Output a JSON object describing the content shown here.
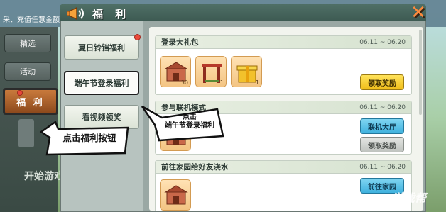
{
  "background": {
    "top_text_prefix": "采、充值任意金额",
    "rail_tabs": [
      "精选",
      "活动"
    ],
    "selected_tab_label": "福 利",
    "start_text": "开始游戏",
    "watermark": "游戏帮"
  },
  "dialog": {
    "title": "福 利",
    "close_label": "✕",
    "menu": [
      {
        "label": "夏日铃铛福利",
        "has_badge": true
      },
      {
        "label": "端午节登录福利",
        "has_badge": false,
        "active": true
      },
      {
        "label": "看视频领奖",
        "has_badge": false
      }
    ],
    "cards": [
      {
        "title": "登录大礼包",
        "date": "06.11 ~ 06.20",
        "items": [
          {
            "icon": "house-block-icon",
            "count": "30"
          },
          {
            "icon": "arch-frame-icon",
            "count": "1"
          },
          {
            "icon": "golden-gift-icon",
            "count": "1"
          }
        ],
        "buttons": [
          {
            "label": "领取奖励",
            "style": "yellow"
          }
        ]
      },
      {
        "title": "参与联机模式",
        "date": "06.11 ~ 06.20",
        "items": [
          {
            "icon": "house-block-icon",
            "count": ""
          }
        ],
        "buttons": [
          {
            "label": "联机大厅",
            "style": "blue"
          },
          {
            "label": "领取奖励",
            "style": "gray"
          }
        ]
      },
      {
        "title": "前往家园给好友浇水",
        "date": "06.11 ~ 06.20",
        "items": [
          {
            "icon": "house-block-icon",
            "count": ""
          }
        ],
        "buttons": [
          {
            "label": "前往家园",
            "style": "blue"
          }
        ]
      }
    ]
  },
  "callouts": {
    "click_welfare": "点击福利按钮",
    "dragon_boat_line1": "点击",
    "dragon_boat_line2": "端午节登录福利"
  },
  "colors": {
    "accent_orange": "#c97a3c",
    "badge_red": "#ea4a3c",
    "yellow_button": "#f0bd1a",
    "blue_button": "#3fb1de"
  }
}
